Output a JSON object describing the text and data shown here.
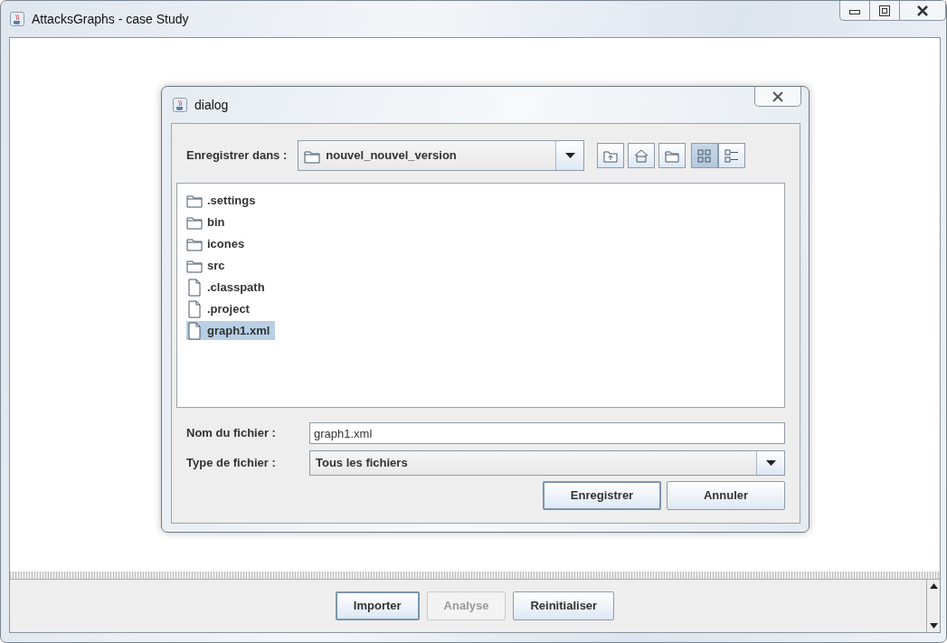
{
  "window": {
    "title": "AttacksGraphs - case Study"
  },
  "dialog": {
    "title": "dialog",
    "save_in": {
      "label": "Enregistrer dans :",
      "value": "nouvel_nouvel_version"
    },
    "views": [
      {
        "kind": "list",
        "selected": true
      },
      {
        "kind": "details",
        "selected": false
      }
    ],
    "files": [
      {
        "name": ".settings",
        "kind": "folder",
        "selected": false
      },
      {
        "name": "bin",
        "kind": "folder",
        "selected": false
      },
      {
        "name": "icones",
        "kind": "folder",
        "selected": false
      },
      {
        "name": "src",
        "kind": "folder",
        "selected": false
      },
      {
        "name": ".classpath",
        "kind": "file",
        "selected": false
      },
      {
        "name": ".project",
        "kind": "file",
        "selected": false
      },
      {
        "name": "graph1.xml",
        "kind": "file",
        "selected": true
      }
    ],
    "file_name": {
      "label": "Nom du fichier :",
      "value": "graph1.xml"
    },
    "file_type": {
      "label": "Type de fichier :",
      "value": "Tous les fichiers"
    },
    "buttons": [
      {
        "label": "Enregistrer",
        "focused": true
      },
      {
        "label": "Annuler",
        "focused": false
      }
    ]
  },
  "bottom_buttons": [
    {
      "label": "Importer",
      "disabled": false,
      "focused": true
    },
    {
      "label": "Analyse",
      "disabled": true,
      "focused": false
    },
    {
      "label": "Reinitialiser",
      "disabled": false,
      "focused": false
    }
  ]
}
